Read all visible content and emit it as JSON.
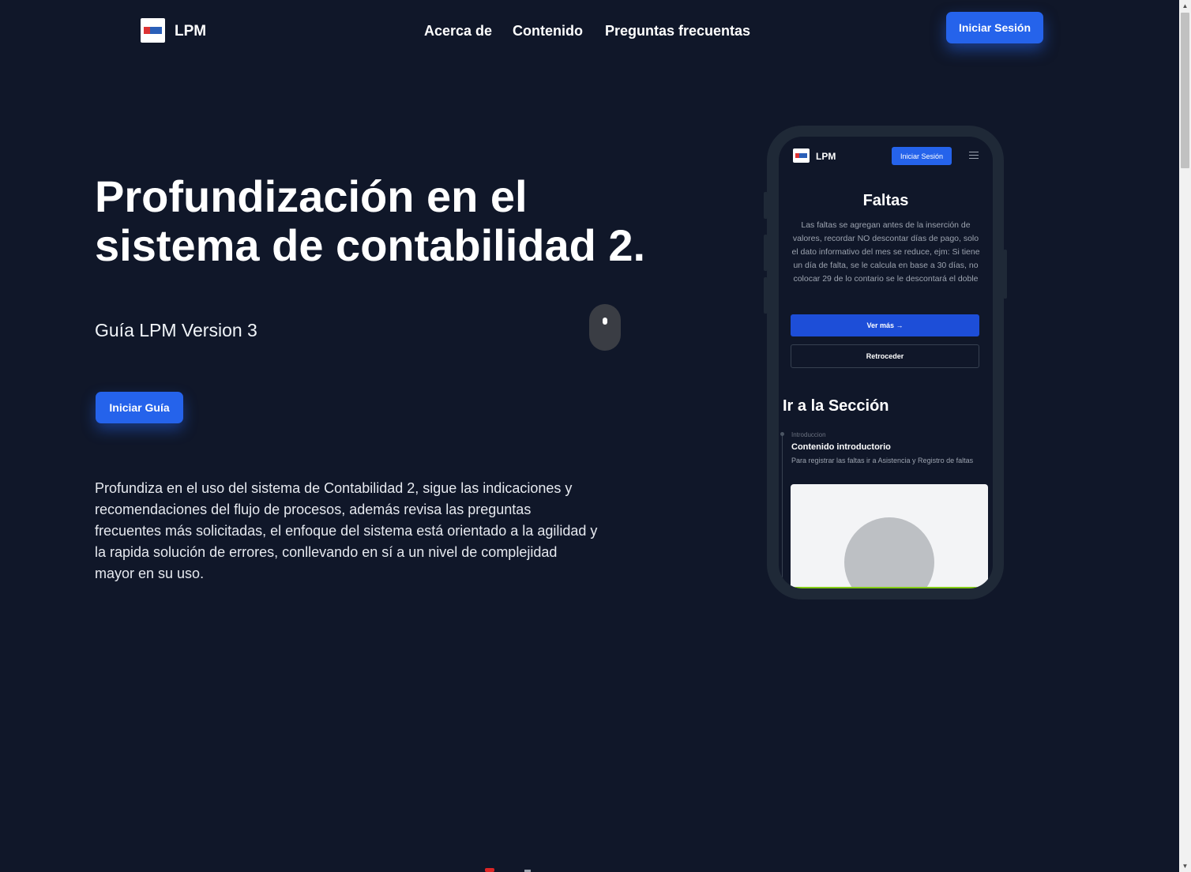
{
  "header": {
    "brand": "LPM",
    "nav": [
      "Acerca de",
      "Contenido",
      "Preguntas frecuentas"
    ],
    "login_label": "Iniciar Sesión"
  },
  "hero": {
    "title": "Profundización en el sistema de contabilidad 2.",
    "subtitle": "Guía LPM Version 3",
    "cta_label": "Iniciar Guía",
    "description": "Profundiza en el uso del sistema de Contabilidad 2, sigue las indicaciones y recomendaciones del flujo de procesos, además revisa las preguntas frecuentes más solicitadas, el enfoque del sistema está orientado a la agilidad y la rapida solución de errores, conllevando en sí a un nivel de complejidad mayor en su uso."
  },
  "phone": {
    "brand": "LPM",
    "login_label": "Iniciar Sesión",
    "title": "Faltas",
    "text": "Las faltas se agregan antes de la inserción de valores, recordar NO descontar días de pago, solo el dato informativo del mes se reduce, ejm: Si tiene un día de falta, se le calcula en base a 30 días, no colocar 29 de lo contario se le descontará el doble",
    "ver_mas_label": "Ver más →",
    "back_label": "Retroceder",
    "section_title": "Ir a la Sección",
    "intro_category": "Introduccion",
    "intro_title": "Contenido introductorio",
    "intro_desc": "Para registrar las faltas ir a Asistencia y Registro de faltas"
  },
  "colors": {
    "background": "#101729",
    "accent": "#2563eb",
    "phone_frame": "#1f2937"
  },
  "icons": [
    "logo-icon",
    "menu-icon",
    "mouse-scroll-icon",
    "arrow-right-icon"
  ]
}
